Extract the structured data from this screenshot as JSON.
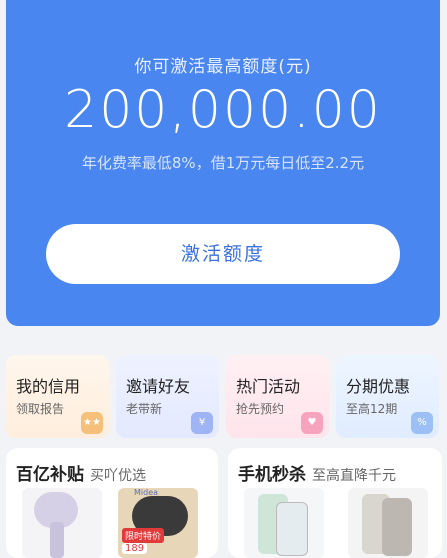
{
  "hero": {
    "subtitle": "你可激活最高额度(元)",
    "amount": "200,000.00",
    "rate_text": "年化费率最低8%，借1万元每日低至2.2元",
    "button_label": "激活额度"
  },
  "cards": [
    {
      "title": "我的信用",
      "subtitle": "领取报告",
      "deco": "★★"
    },
    {
      "title": "邀请好友",
      "subtitle": "老带新",
      "deco": "¥"
    },
    {
      "title": "热门活动",
      "subtitle": "抢先预约",
      "deco": "♥"
    },
    {
      "title": "分期优惠",
      "subtitle": "至高12期",
      "deco": "%"
    }
  ],
  "promo": [
    {
      "title": "百亿补贴",
      "subtitle": "买吖优选",
      "products": [
        {
          "name": "hair-dryer"
        },
        {
          "name": "induction-cooker",
          "brand": "Midea",
          "badge": "限时特价",
          "price": "189"
        }
      ]
    },
    {
      "title": "手机秒杀",
      "subtitle": "至高直降千元",
      "products": [
        {
          "name": "foldable-phone"
        },
        {
          "name": "smartphone"
        }
      ]
    }
  ],
  "colors": {
    "primary": "#4a86f0",
    "background": "#f2f3f7",
    "accent_red": "#e23a3a"
  }
}
